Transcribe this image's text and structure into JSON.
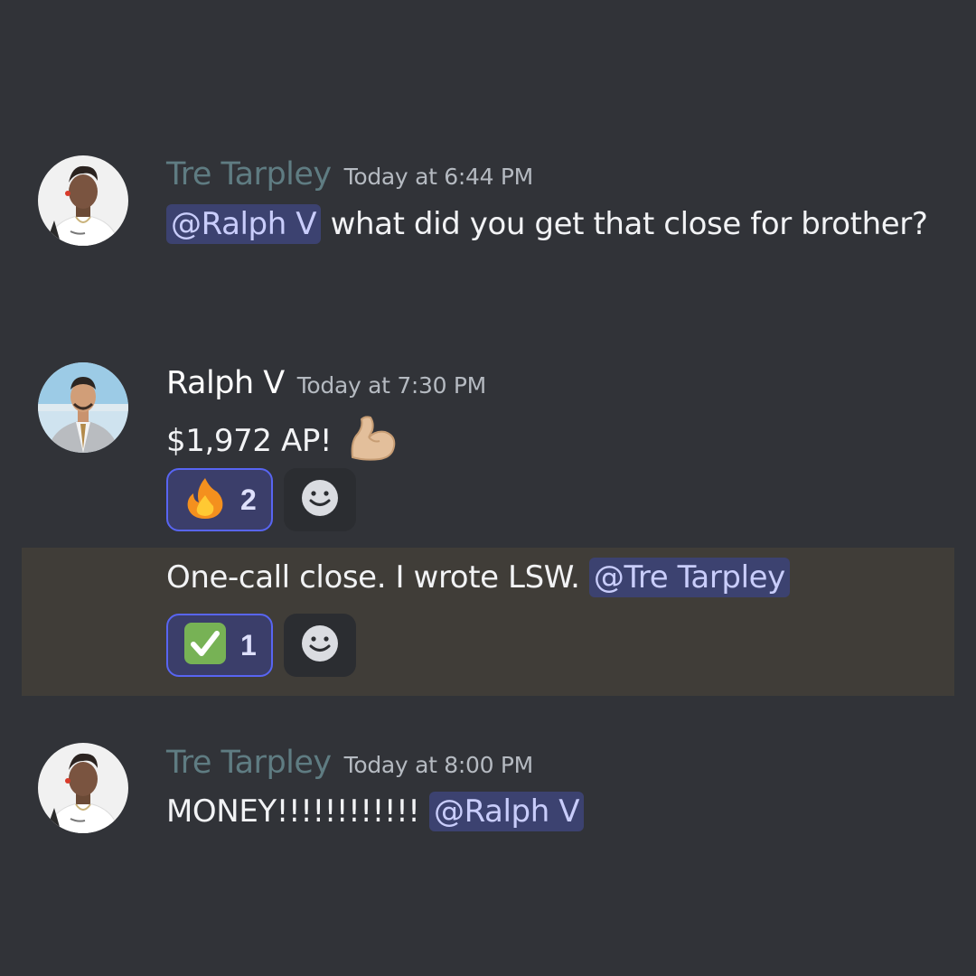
{
  "messages": [
    {
      "author": "Tre Tarpley",
      "timestamp": "Today at 6:44 PM",
      "mention": "@Ralph V",
      "text": "what did you get that close for brother?"
    },
    {
      "author": "Ralph V",
      "timestamp": "Today at 7:30 PM",
      "text": "$1,972 AP!",
      "emoji_icon": "flexed-biceps-icon",
      "reaction": {
        "emoji_icon": "fire-icon",
        "count": "2"
      }
    },
    {
      "text": "One-call close. I wrote LSW.",
      "mention": "@Tre Tarpley",
      "reaction": {
        "emoji_icon": "check-mark-button-icon",
        "count": "1"
      }
    },
    {
      "author": "Tre Tarpley",
      "timestamp": "Today at 8:00 PM",
      "text": "MONEY!!!!!!!!!!!!",
      "mention": "@Ralph V"
    }
  ],
  "colors": {
    "background": "#313338",
    "highlight": "#403d38",
    "mention_bg": "#3c4270",
    "mention_text": "#c9cdfb",
    "reaction_border": "#5865f2"
  }
}
